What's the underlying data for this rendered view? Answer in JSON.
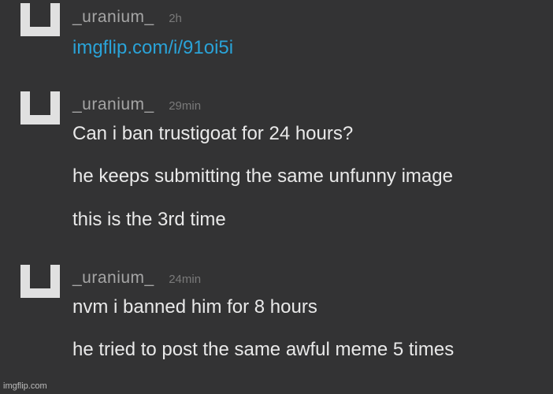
{
  "comments": [
    {
      "username": "_uranium_",
      "time": "2h",
      "lines": [
        "imgflip.com/i/91oi5i"
      ]
    },
    {
      "username": "_uranium_",
      "time": "29min",
      "lines": [
        "Can i ban trustigoat for 24 hours?",
        "he keeps submitting the same unfunny image",
        "this is the 3rd time"
      ]
    },
    {
      "username": "_uranium_",
      "time": "24min",
      "lines": [
        "nvm i banned him for 8 hours",
        "he tried to post the same awful meme 5 times"
      ]
    }
  ],
  "watermark": "imgflip.com",
  "colors": {
    "background": "#333334",
    "link": "#2aa3d8",
    "username": "#a5a5a5",
    "timestamp": "#7a7a7a",
    "avatar": "#e0e0e0"
  },
  "icons": {
    "avatar": "user-avatar-icon"
  }
}
